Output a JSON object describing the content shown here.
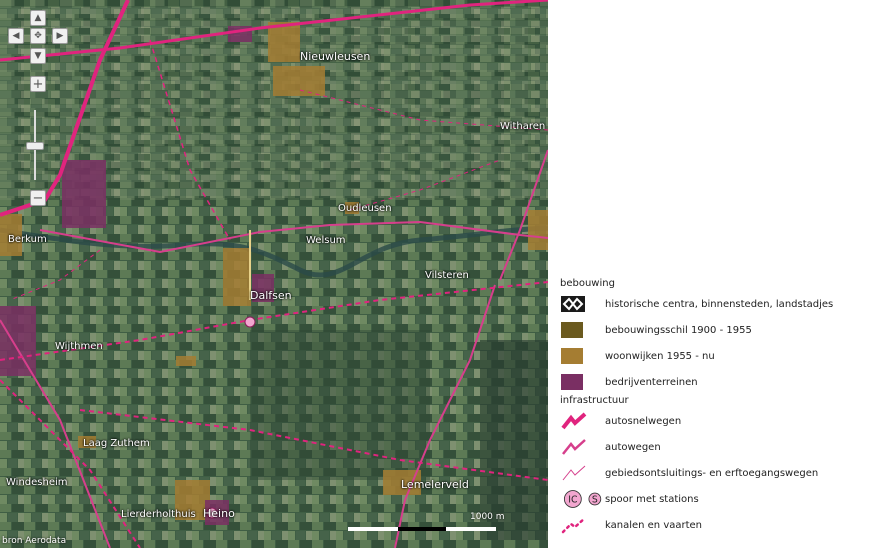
{
  "map": {
    "places": [
      {
        "name": "Nieuwleusen",
        "big": true
      },
      {
        "name": "Witharen",
        "big": false
      },
      {
        "name": "Berkum",
        "big": false
      },
      {
        "name": "Oudleusen",
        "big": false
      },
      {
        "name": "Welsum",
        "big": false
      },
      {
        "name": "Vilsteren",
        "big": false
      },
      {
        "name": "Dalfsen",
        "big": true
      },
      {
        "name": "Wijthmen",
        "big": false
      },
      {
        "name": "Laag Zuthem",
        "big": false
      },
      {
        "name": "Windesheim",
        "big": false
      },
      {
        "name": "Lierderholthuis",
        "big": false
      },
      {
        "name": "Heino",
        "big": true
      },
      {
        "name": "Lemelerveld",
        "big": true
      }
    ],
    "credit": "bron Aerodata",
    "scale_label": "1000 m",
    "colors": {
      "motorway": "#e0247e",
      "road": "#d63f8c",
      "historic": "#1a1a1a",
      "pre1955": "#6b5a1f",
      "residential": "#a57d32",
      "industrial": "#7a2f63",
      "station": "#f2a6cf"
    }
  },
  "nav": {
    "up": "▲",
    "down": "▼",
    "left": "◀",
    "right": "▶",
    "center": "✥",
    "zoom_in": "+",
    "zoom_out": "−"
  },
  "legend": {
    "group1_title": "bebouwing",
    "group2_title": "infrastructuur",
    "items": [
      {
        "label": "historische centra, binnensteden, landstadjes"
      },
      {
        "label": "bebouwingsschil 1900 - 1955"
      },
      {
        "label": "woonwijken 1955 - nu"
      },
      {
        "label": "bedrijventerreinen"
      },
      {
        "label": "autosnelwegen"
      },
      {
        "label": "autowegen"
      },
      {
        "label": "gebiedsontsluitings- en erftoegangswegen"
      },
      {
        "label": "spoor met stations"
      },
      {
        "label": "kanalen en vaarten"
      }
    ],
    "station_symbols": [
      "IC",
      "S"
    ]
  }
}
